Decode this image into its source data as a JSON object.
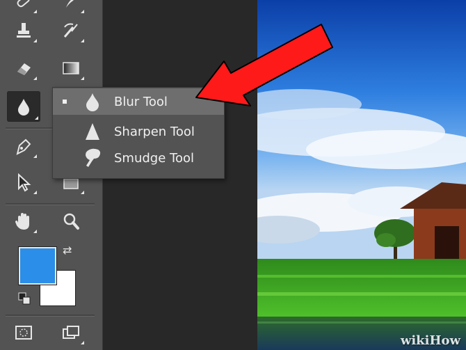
{
  "toolbar": {
    "tools": [
      {
        "name": "blur-tool",
        "icon": "water-drop-icon",
        "active": true,
        "has_submenu": true
      },
      {
        "name": "pen-tool",
        "icon": "pen-nib-icon"
      },
      {
        "name": "path-selection-tool",
        "icon": "arrow-cursor-icon"
      },
      {
        "name": "hand-tool",
        "icon": "hand-icon"
      },
      {
        "name": "zoom-tool",
        "icon": "magnifier-icon"
      }
    ],
    "foreground_color": "#2b8ee8",
    "background_color": "#ffffff"
  },
  "flyout": {
    "items": [
      {
        "label": "Blur Tool",
        "icon": "water-drop-icon",
        "selected": true
      },
      {
        "label": "Sharpen Tool",
        "icon": "triangle-icon",
        "selected": false
      },
      {
        "label": "Smudge Tool",
        "icon": "finger-icon",
        "selected": false
      }
    ]
  },
  "annotation": {
    "arrow_color": "#ff1a1a"
  },
  "watermark": "wikiHow"
}
